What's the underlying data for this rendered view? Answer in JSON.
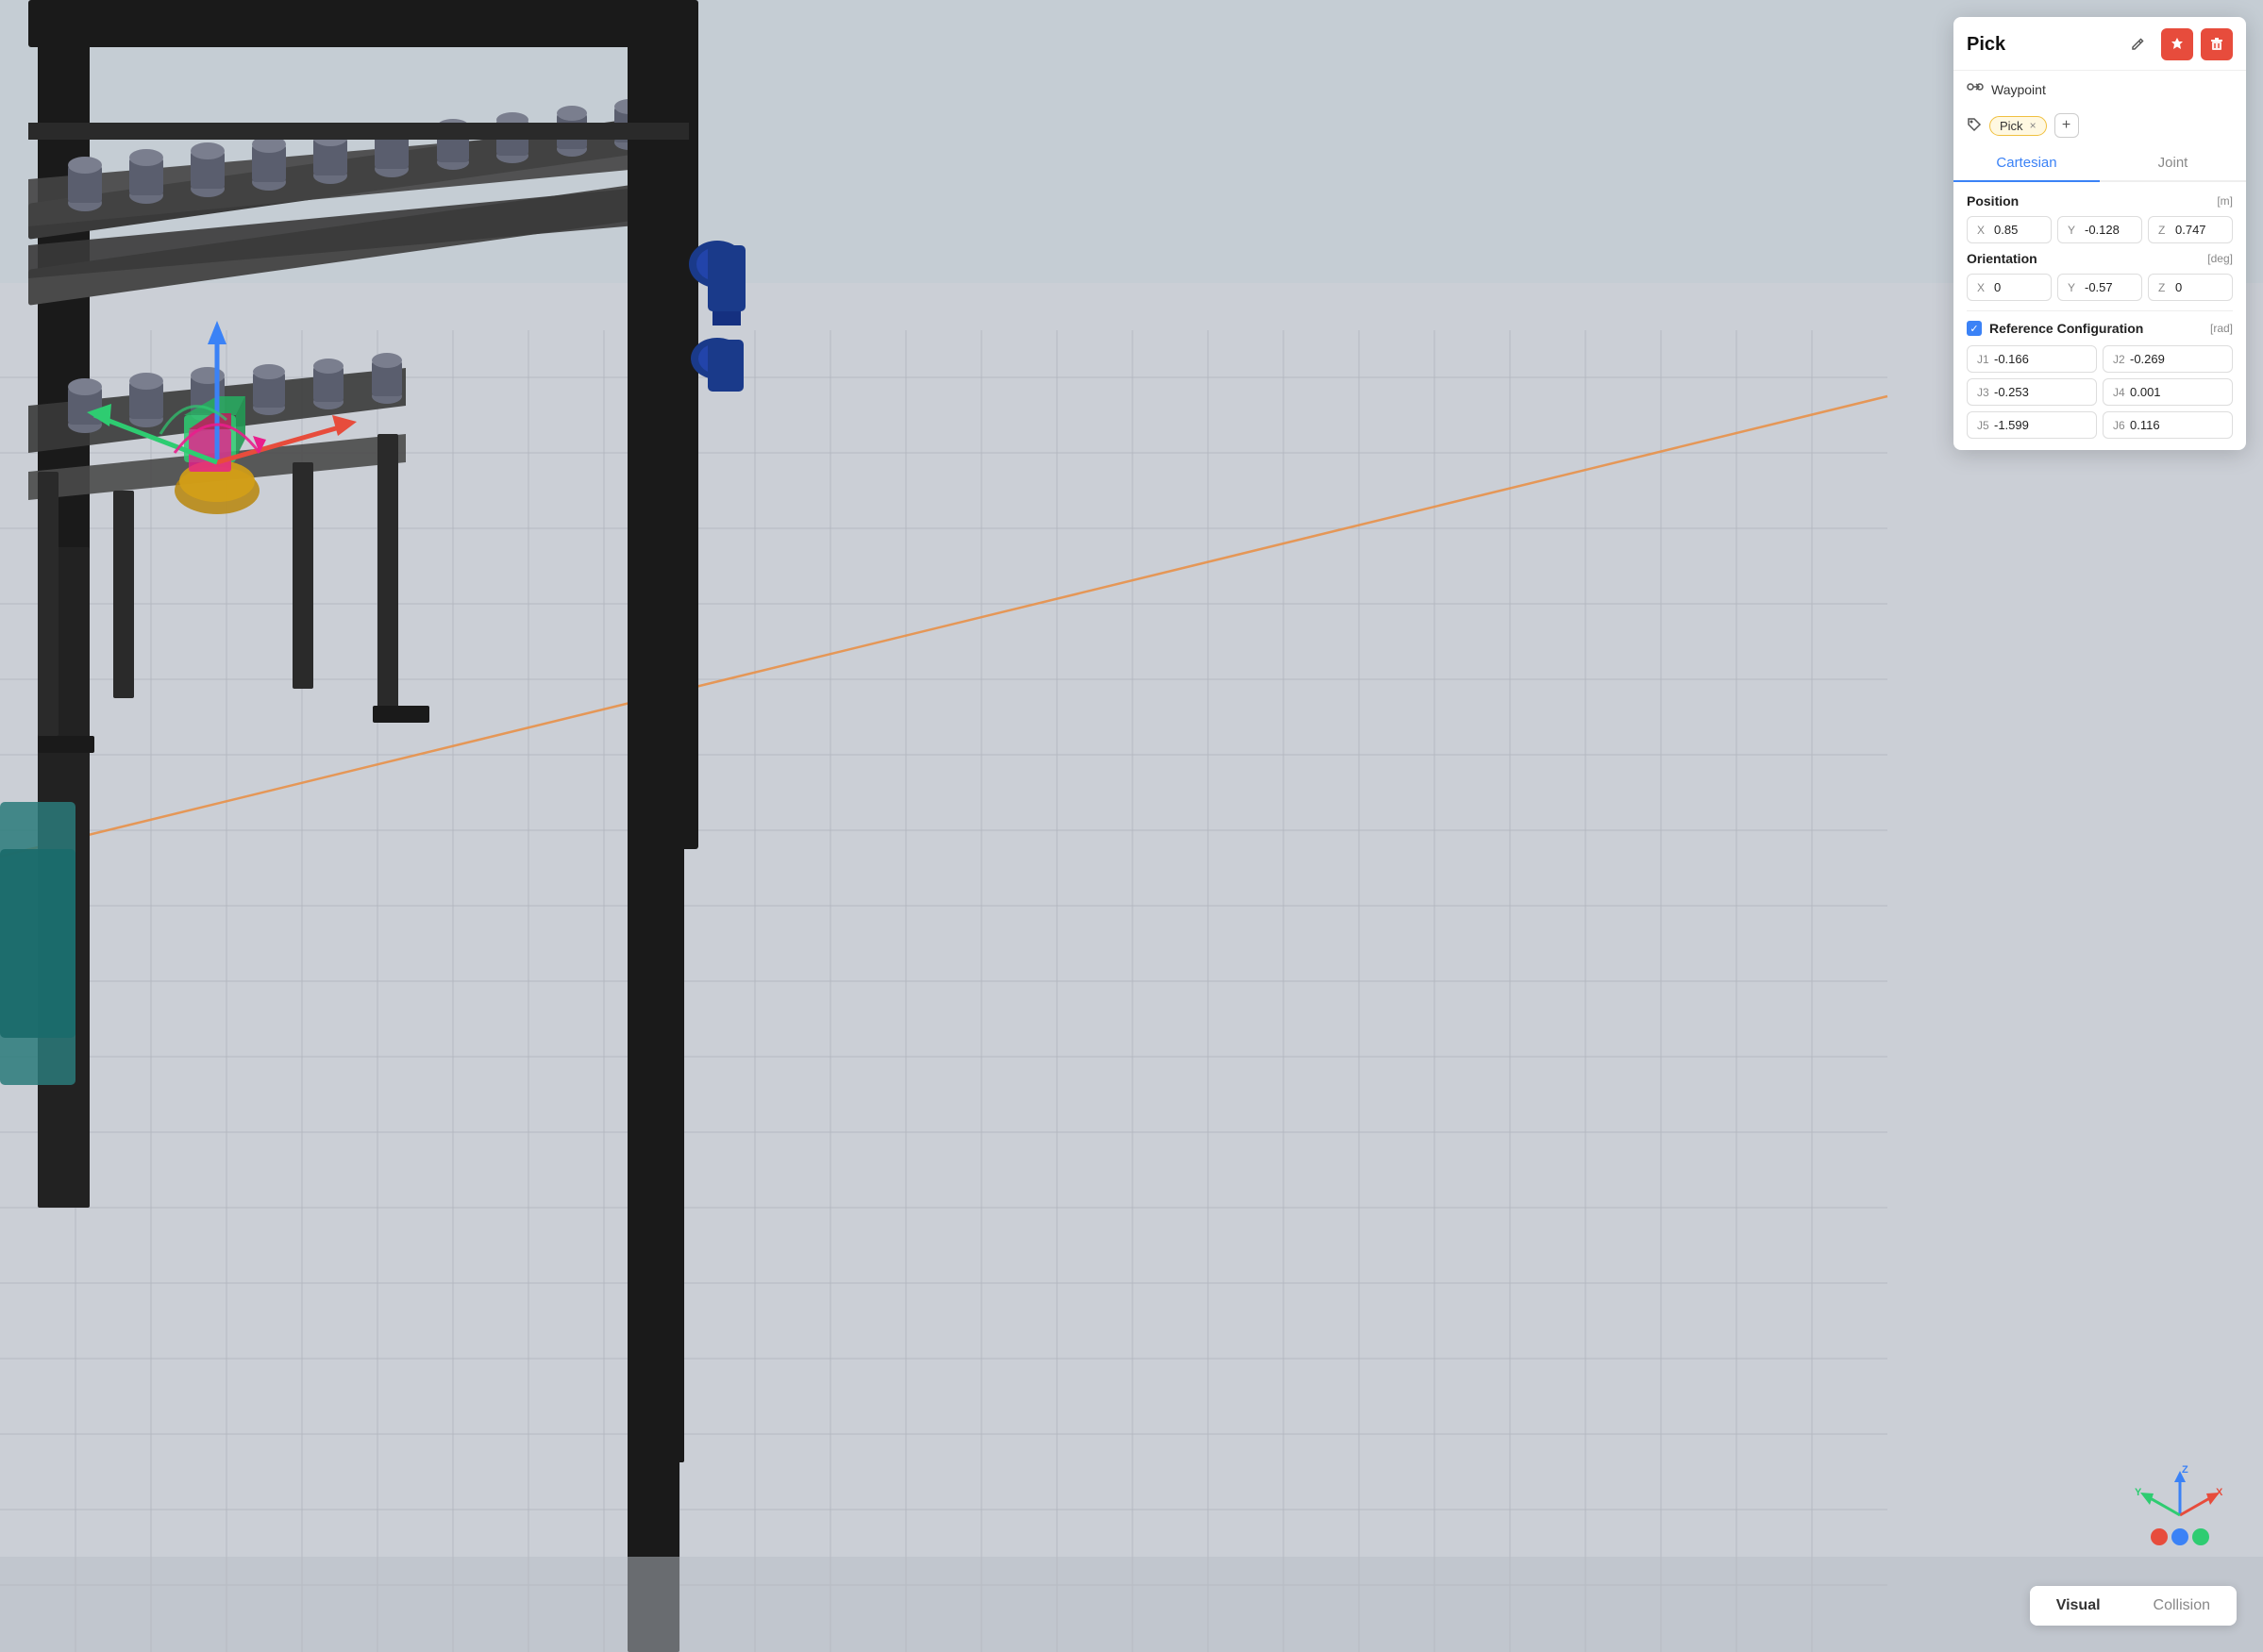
{
  "panel": {
    "title": "Pick",
    "waypoint_label": "Waypoint",
    "tabs": [
      {
        "id": "cartesian",
        "label": "Cartesian"
      },
      {
        "id": "joint",
        "label": "Joint"
      }
    ],
    "active_tab": "cartesian",
    "position": {
      "label": "Position",
      "unit": "[m]",
      "x": {
        "label": "X",
        "value": "0.85"
      },
      "y": {
        "label": "Y",
        "value": "-0.128"
      },
      "z": {
        "label": "Z",
        "value": "0.747"
      }
    },
    "orientation": {
      "label": "Orientation",
      "unit": "[deg]",
      "x": {
        "label": "X",
        "value": "0"
      },
      "y": {
        "label": "Y",
        "value": "-0.57"
      },
      "z": {
        "label": "Z",
        "value": "0"
      }
    },
    "reference_config": {
      "label": "Reference Configuration",
      "unit": "[rad]",
      "j1": {
        "label": "J1",
        "value": "-0.166"
      },
      "j2": {
        "label": "J2",
        "value": "-0.269"
      },
      "j3": {
        "label": "J3",
        "value": "-0.253"
      },
      "j4": {
        "label": "J4",
        "value": "0.001"
      },
      "j5": {
        "label": "J5",
        "value": "-1.599"
      },
      "j6": {
        "label": "J6",
        "value": "0.116"
      }
    },
    "tag": {
      "name": "Pick",
      "add_label": "+"
    },
    "buttons": {
      "edit_icon": "✎",
      "pin_icon": "📌",
      "delete_icon": "🗑"
    }
  },
  "bottom_buttons": {
    "visual": "Visual",
    "collision": "Collision"
  },
  "axes": {
    "x_color": "#e74c3c",
    "y_color": "#2ecc71",
    "z_color": "#3b82f6",
    "x_label": "X",
    "y_label": "Y",
    "z_label": "Z"
  }
}
